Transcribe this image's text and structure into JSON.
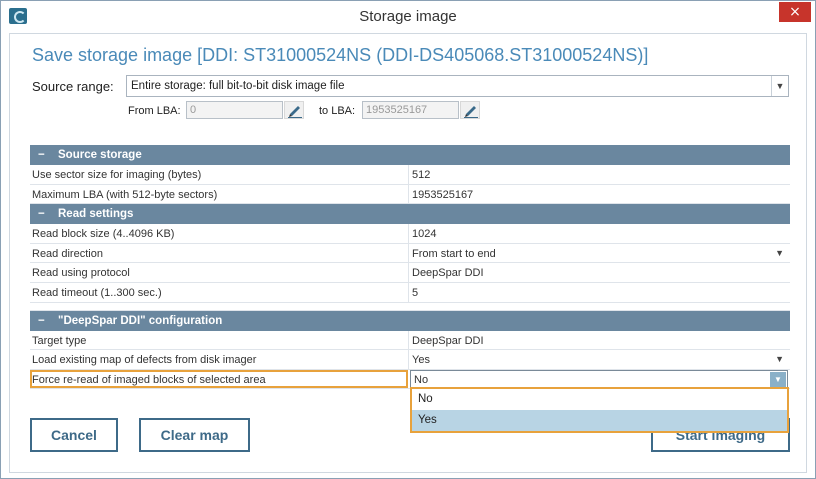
{
  "window": {
    "title": "Storage image"
  },
  "dialog": {
    "heading": "Save storage image [DDI: ST31000524NS (DDI-DS405068.ST31000524NS)]",
    "source_range_label": "Source range:",
    "source_range_value": "Entire storage: full bit-to-bit disk image file",
    "from_lba_label": "From LBA:",
    "from_lba_value": "0",
    "to_lba_label": "to LBA:",
    "to_lba_value": "1953525167"
  },
  "sections": [
    {
      "title": "Source storage",
      "rows": [
        {
          "key": "Use sector size for imaging (bytes)",
          "value": "512"
        },
        {
          "key": "Maximum LBA (with 512-byte sectors)",
          "value": "1953525167"
        }
      ]
    },
    {
      "title": "Read settings",
      "rows": [
        {
          "key": "Read block size (4..4096 KB)",
          "value": "1024"
        },
        {
          "key": "Read direction",
          "value": "From start to end"
        },
        {
          "key": "Read using protocol",
          "value": "DeepSpar DDI"
        },
        {
          "key": "Read timeout (1..300 sec.)",
          "value": "5"
        }
      ]
    },
    {
      "title": "\"DeepSpar DDI\" configuration",
      "rows": [
        {
          "key": "Target type",
          "value": "DeepSpar DDI"
        },
        {
          "key": "Load existing map of defects from disk imager",
          "value": "Yes"
        },
        {
          "key": "Force re-read of imaged blocks of selected area",
          "value": "No"
        }
      ]
    }
  ],
  "dropdown_options": [
    "No",
    "Yes"
  ],
  "buttons": {
    "cancel": "Cancel",
    "clear_map": "Clear map",
    "start_imaging": "Start imaging"
  },
  "icons": {
    "close": "×",
    "collapse": "−",
    "arrow": "▼"
  },
  "colors": {
    "accent": "#4a8ab8",
    "section_header": "#6a879f",
    "focus": "#e8a23c",
    "button": "#3e6a88",
    "close": "#c7342b"
  }
}
